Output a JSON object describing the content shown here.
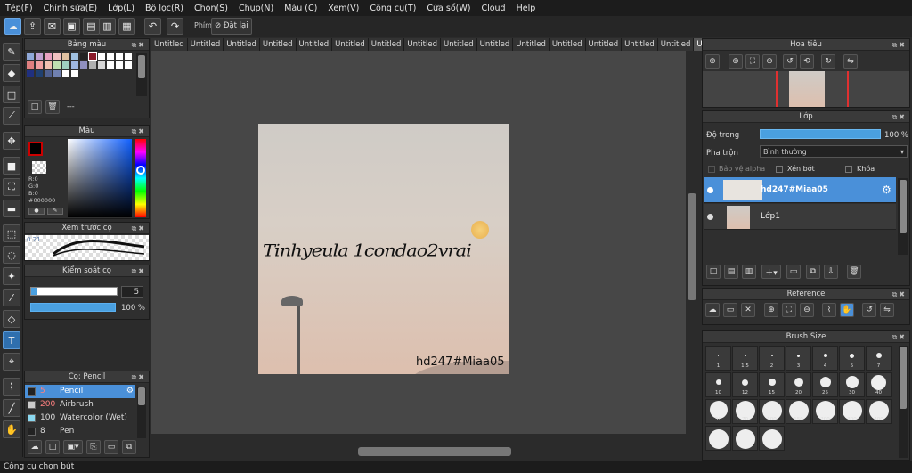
{
  "menu": [
    "Tệp(F)",
    "Chỉnh sửa(E)",
    "Lớp(L)",
    "Bộ lọc(R)",
    "Chọn(S)",
    "Chụp(N)",
    "Màu (C)",
    "Xem(V)",
    "Công cụ(T)",
    "Cửa sổ(W)",
    "Cloud",
    "Help"
  ],
  "toolbar": {
    "key_label": "Phím",
    "reset_label": "Đặt lại"
  },
  "tabs": [
    "Untitled",
    "Untitled",
    "Untitled",
    "Untitled",
    "Untitled",
    "Untitled",
    "Untitled",
    "Untitled",
    "Untitled",
    "Untitled",
    "Untitled",
    "Untitled",
    "Untitled",
    "Untitled",
    "Untitled",
    "Untitled"
  ],
  "palette": {
    "title": "Bảng màu",
    "dash": "---",
    "colors": [
      "#8fa8d8",
      "#c0a0d0",
      "#e8a0c0",
      "#f0c0c0",
      "#e0c0a0",
      "#a0c0e0",
      "#222222",
      "#8a1a2a",
      "#ffffff",
      "#ffffff",
      "#ffffff",
      "#ffffff",
      "#e08080",
      "#f0a0a0",
      "#f0c0b0",
      "#c0e0b0",
      "#a0d0c0",
      "#a0b8e0",
      "#9090c0",
      "#b0b0b0",
      "#d8d8d8",
      "#ffffff",
      "#ffffff",
      "#ffffff",
      "#203080",
      "#204070",
      "#506090",
      "#7080b0",
      "#ffffff",
      "#ffffff"
    ]
  },
  "color": {
    "title": "Màu",
    "r": "R:0",
    "g": "G:0",
    "b": "B:0",
    "hex": "#000000",
    "primary": "#000000"
  },
  "preview": {
    "title": "Xem trước cọ",
    "size": "0.21"
  },
  "brushcontrol": {
    "title": "Kiểm soát cọ",
    "size": "5",
    "opacity": "100 %"
  },
  "brushlist": {
    "title": "Cọ: Pencil",
    "items": [
      {
        "size": "5",
        "name": "Pencil"
      },
      {
        "size": "200",
        "name": "Airbrush"
      },
      {
        "size": "100",
        "name": "Watercolor (Wet)"
      },
      {
        "size": "8",
        "name": "Pen"
      }
    ]
  },
  "canvas": {
    "handwriting": "Tinhyeula 1condao2vrai",
    "watermark": "hd247#Miaa05"
  },
  "navigator": {
    "title": "Hoa tiêu"
  },
  "layers": {
    "title": "Lớp",
    "opacity_label": "Độ trong",
    "opacity_value": "100 %",
    "blend_label": "Pha trộn",
    "blend_value": "Bình thường",
    "protect_alpha": "Bảo vệ alpha",
    "clipping": "Xén bớt",
    "lock": "Khóa",
    "items": [
      "hd247#Miaa05",
      "Lớp1"
    ]
  },
  "reference": {
    "title": "Reference"
  },
  "brushsize": {
    "title": "Brush Size",
    "sizes": [
      "1",
      "1.5",
      "2",
      "3",
      "4",
      "5",
      "7",
      "10",
      "12",
      "15",
      "20",
      "25",
      "30",
      "40",
      "50",
      "70",
      "100",
      "150",
      "200",
      "300",
      "400",
      "",
      "",
      ""
    ]
  },
  "status": "Công cụ chọn bút"
}
